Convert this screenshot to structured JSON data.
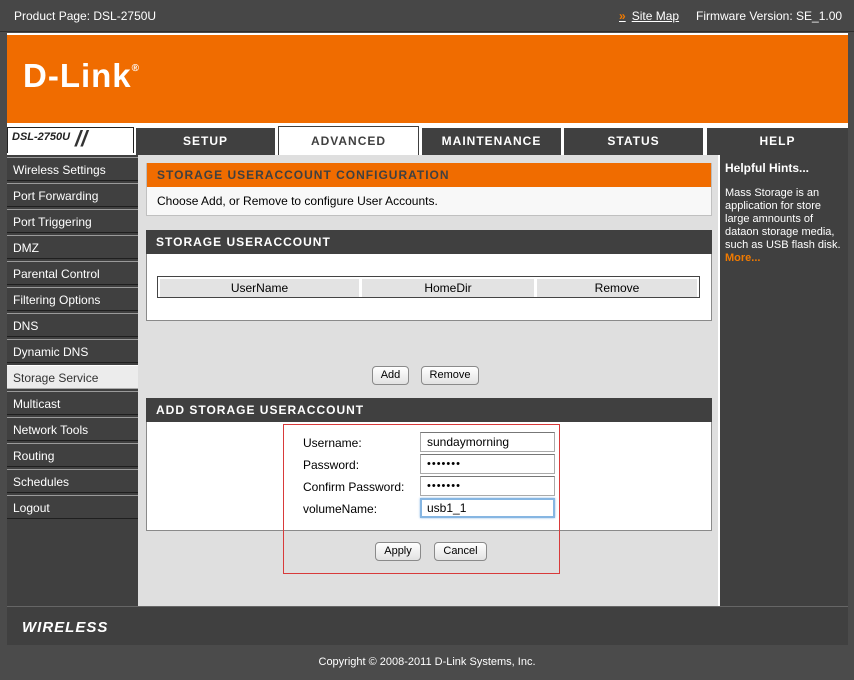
{
  "topbar": {
    "product": "Product Page: DSL-2750U",
    "sitemap": "Site Map",
    "firmware": "Firmware Version: SE_1.00"
  },
  "brand": {
    "logo": "D-Link",
    "trademark": "®"
  },
  "model": "DSL-2750U",
  "tabs": [
    "SETUP",
    "ADVANCED",
    "MAINTENANCE",
    "STATUS",
    "HELP"
  ],
  "active_tab": "ADVANCED",
  "nav": [
    "Wireless Settings",
    "Port Forwarding",
    "Port Triggering",
    "DMZ",
    "Parental Control",
    "Filtering Options",
    "DNS",
    "Dynamic DNS",
    "Storage Service",
    "Multicast",
    "Network Tools",
    "Routing",
    "Schedules",
    "Logout"
  ],
  "active_nav": "Storage Service",
  "config": {
    "title": "STORAGE USERACCOUNT CONFIGURATION",
    "info": "Choose Add, or Remove to configure User Accounts."
  },
  "accounts": {
    "title": "STORAGE USERACCOUNT",
    "columns": [
      "UserName",
      "HomeDir",
      "Remove"
    ],
    "add_label": "Add",
    "remove_label": "Remove"
  },
  "add_form": {
    "title": "ADD STORAGE USERACCOUNT",
    "username_label": "Username:",
    "username_value": "sundaymorning",
    "password_label": "Password:",
    "password_value": "•••••••",
    "confirm_label": "Confirm Password:",
    "confirm_value": "•••••••",
    "volume_label": "volumeName:",
    "volume_value": "usb1_1",
    "apply_label": "Apply",
    "cancel_label": "Cancel"
  },
  "hints": {
    "title": "Helpful Hints...",
    "text": "Mass Storage is an application for store large amnounts of dataon storage media, such as USB flash disk.",
    "more": "More..."
  },
  "footer": {
    "wireless": "WIRELESS",
    "copyright": "Copyright © 2008-2011 D-Link Systems, Inc."
  },
  "colors": {
    "accent": "#f06c00",
    "dark": "#404040"
  }
}
